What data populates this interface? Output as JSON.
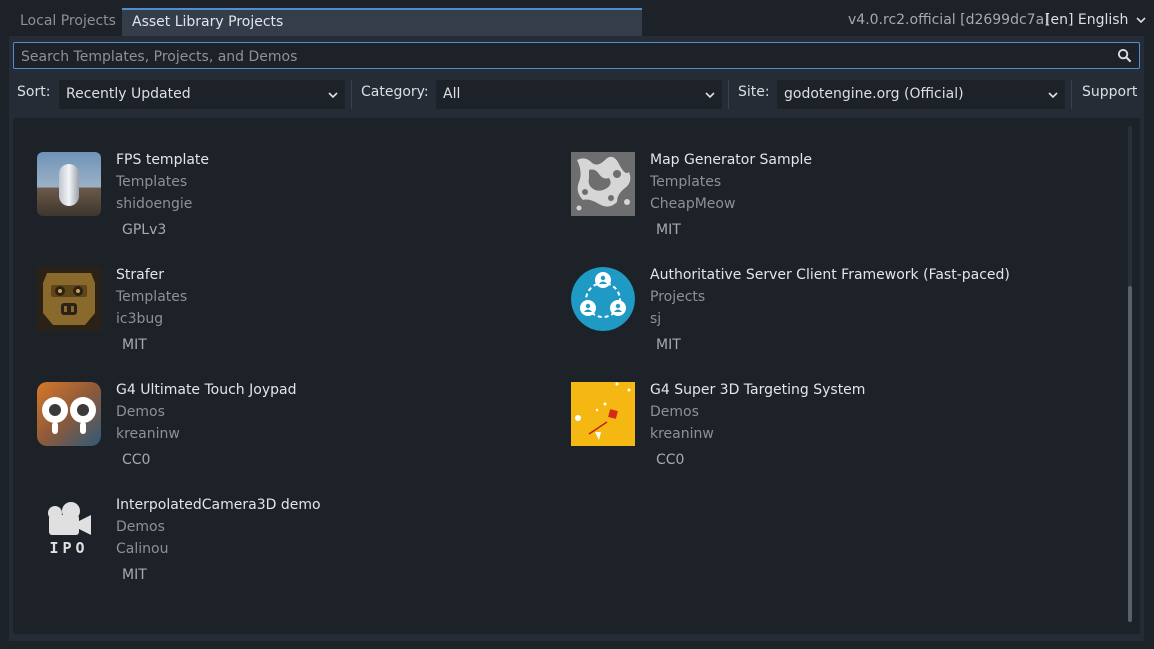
{
  "tabs": [
    {
      "label": "Local Projects",
      "active": false
    },
    {
      "label": "Asset Library Projects",
      "active": true
    }
  ],
  "version": "v4.0.rc2.official [d2699dc7a]",
  "language": "[en] English",
  "search": {
    "placeholder": "Search Templates, Projects, and Demos",
    "value": ""
  },
  "filters": {
    "sort_label": "Sort:",
    "sort_value": "Recently Updated",
    "category_label": "Category:",
    "category_value": "All",
    "site_label": "Site:",
    "site_value": "godotengine.org (Official)",
    "support_label": "Support"
  },
  "assets": [
    {
      "title": "FPS template",
      "category": "Templates",
      "author": "shidoengie",
      "license": "GPLv3",
      "icon": "fps-template-icon"
    },
    {
      "title": "Map Generator Sample",
      "category": "Templates",
      "author": "CheapMeow",
      "license": "MIT",
      "icon": "map-generator-icon"
    },
    {
      "title": "Strafer",
      "category": "Templates",
      "author": "ic3bug",
      "license": "MIT",
      "icon": "strafer-icon"
    },
    {
      "title": "Authoritative Server Client Framework (Fast-paced)",
      "category": "Projects",
      "author": "sj",
      "license": "MIT",
      "icon": "network-icon"
    },
    {
      "title": "G4 Ultimate Touch Joypad",
      "category": "Demos",
      "author": "kreaninw",
      "license": "CC0",
      "icon": "joypad-icon"
    },
    {
      "title": "G4 Super 3D Targeting System",
      "category": "Demos",
      "author": "kreaninw",
      "license": "CC0",
      "icon": "targeting-icon"
    },
    {
      "title": "InterpolatedCamera3D demo",
      "category": "Demos",
      "author": "Calinou",
      "license": "MIT",
      "icon": "camera-icon"
    }
  ],
  "icon_text": {
    "camera_caption": "IPO"
  },
  "colors": {
    "accent": "#4d8fcf",
    "background": "#1d2229",
    "panel": "#262c36"
  }
}
